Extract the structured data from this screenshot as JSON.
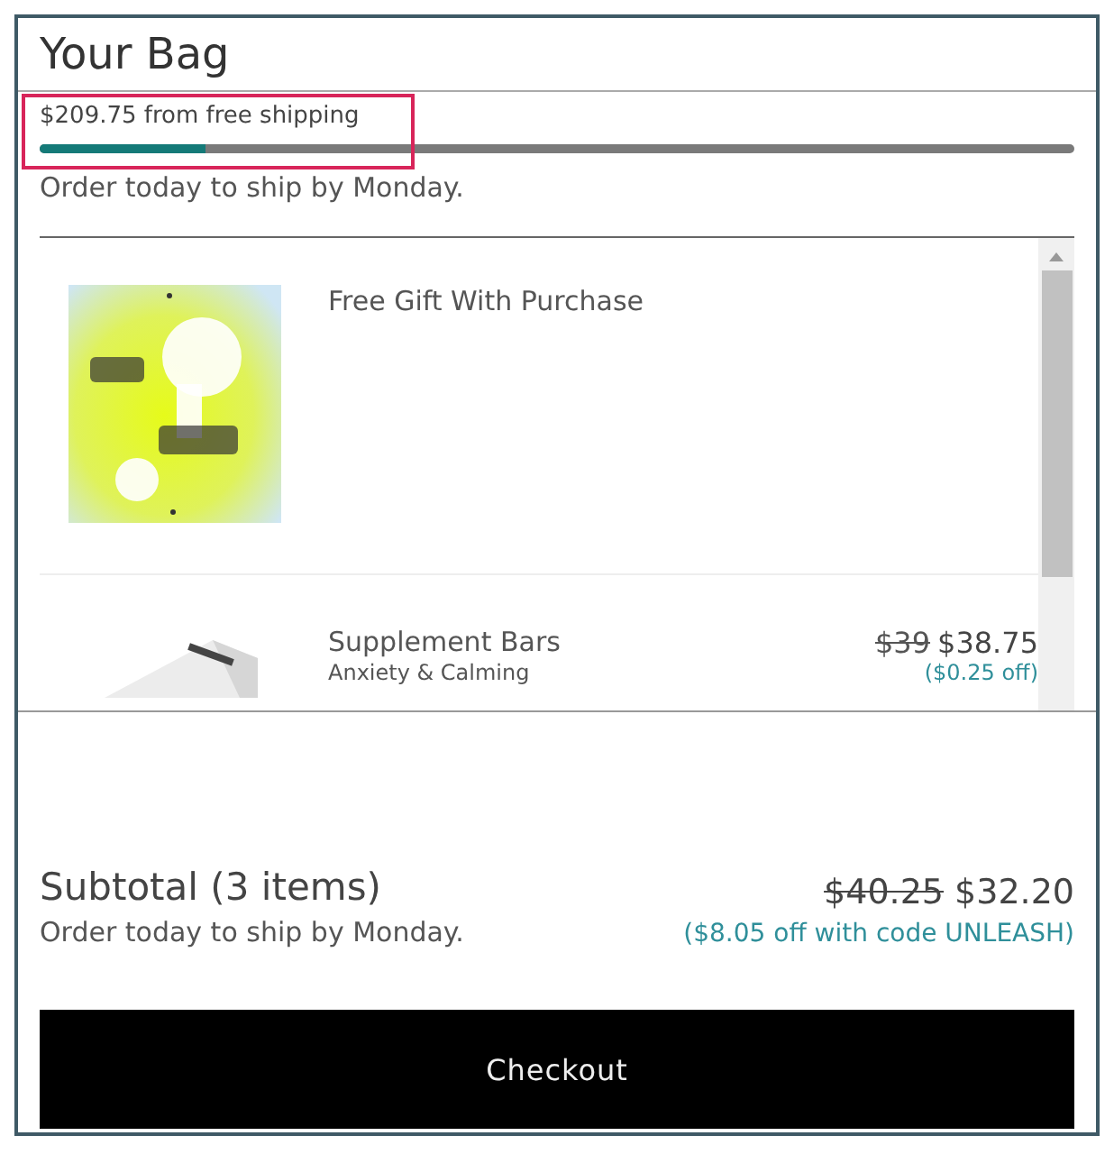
{
  "title": "Your Bag",
  "shipping": {
    "message": "$209.75 from free shipping",
    "level": 0.16,
    "highlighted": true
  },
  "ship_note": "Order today to ship by Monday.",
  "items": [
    {
      "kind": "gift",
      "name": "Free Gift With Purchase"
    },
    {
      "kind": "product",
      "name": "Supplement Bars",
      "variant": "Anxiety & Calming",
      "old_price": "$39",
      "price": "$38.75",
      "discount": "($0.25 off)"
    }
  ],
  "subtotal": {
    "label": "Subtotal (3 items)",
    "note": "Order today to ship by Monday.",
    "old_price": "$40.25",
    "price": "$32.20",
    "discount": "($8.05 off with code UNLEASH)"
  },
  "checkout": "Checkout"
}
